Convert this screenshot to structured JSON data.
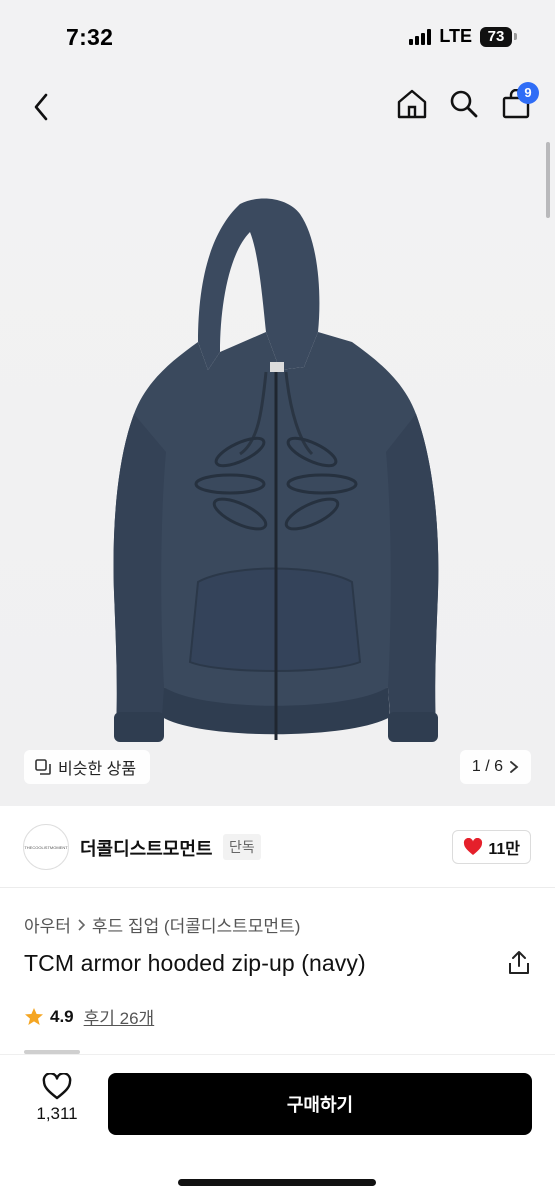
{
  "status_bar": {
    "time": "7:32",
    "network": "LTE",
    "battery": "73"
  },
  "header": {
    "cart_badge": "9"
  },
  "hero": {
    "similar_label": "비슷한 상품",
    "pager": "1 / 6"
  },
  "brand": {
    "logo_text": "THECOOLISTMOMENT",
    "name": "더콜디스트모먼트",
    "tag": "단독",
    "likes": "11만"
  },
  "product": {
    "category_root": "아우터",
    "category_path": "후드 집업 (더콜디스트모먼트)",
    "title": "TCM armor hooded zip-up (navy)",
    "rating": "4.9",
    "reviews": "후기 26개"
  },
  "bottom": {
    "wish_count": "1,311",
    "buy_label": "구매하기"
  },
  "colors": {
    "hoodie": "#3b4a5f",
    "accent_blue": "#2f6df6",
    "heart_red": "#e5202b",
    "star": "#f5a623"
  }
}
